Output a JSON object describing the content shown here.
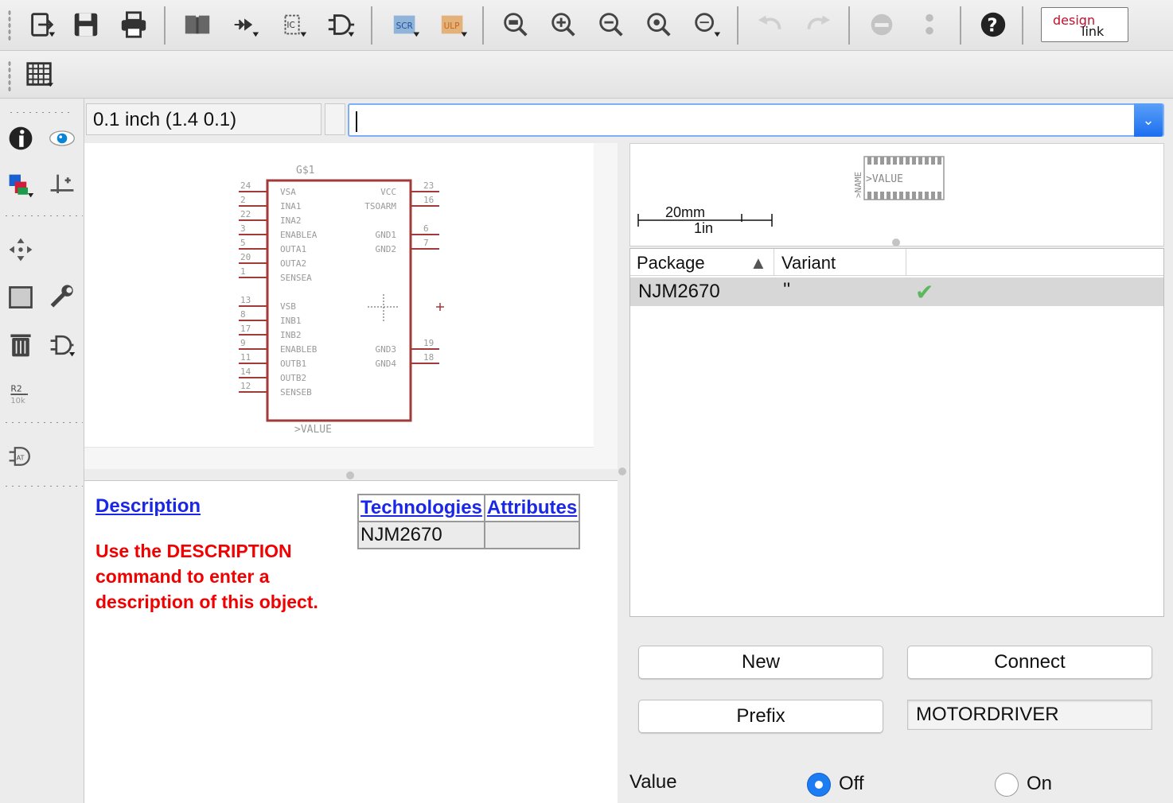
{
  "toolbar": {
    "buttons": [
      {
        "name": "export-icon"
      },
      {
        "name": "save-icon"
      },
      {
        "name": "print-icon"
      },
      {
        "name": "library-icon"
      },
      {
        "name": "pin-direction-icon"
      },
      {
        "name": "device-ic-icon"
      },
      {
        "name": "symbol-gate-icon"
      },
      {
        "name": "script-icon",
        "label": "SCR"
      },
      {
        "name": "ulp-icon",
        "label": "ULP"
      },
      {
        "name": "zoom-fit-icon"
      },
      {
        "name": "zoom-in-icon"
      },
      {
        "name": "zoom-out-icon"
      },
      {
        "name": "zoom-select-icon"
      },
      {
        "name": "zoom-last-icon"
      },
      {
        "name": "undo-icon"
      },
      {
        "name": "redo-icon"
      },
      {
        "name": "stop-icon"
      },
      {
        "name": "go-icon"
      },
      {
        "name": "help-icon"
      }
    ],
    "designlink_label_top": "design",
    "designlink_label_bottom": "link"
  },
  "grid_field": "0.1 inch (1.4 0.1)",
  "command": {
    "value": "",
    "placeholder": ""
  },
  "schematic": {
    "gate_name": "G$1",
    "value_label": ">VALUE",
    "left_pins": [
      {
        "num": "24",
        "name": "VSA"
      },
      {
        "num": "2",
        "name": "INA1"
      },
      {
        "num": "22",
        "name": "INA2"
      },
      {
        "num": "3",
        "name": "ENABLEA"
      },
      {
        "num": "5",
        "name": "OUTA1"
      },
      {
        "num": "20",
        "name": "OUTA2"
      },
      {
        "num": "1",
        "name": "SENSEA"
      },
      {
        "num": "13",
        "name": "VSB"
      },
      {
        "num": "8",
        "name": "INB1"
      },
      {
        "num": "17",
        "name": "INB2"
      },
      {
        "num": "9",
        "name": "ENABLEB"
      },
      {
        "num": "11",
        "name": "OUTB1"
      },
      {
        "num": "14",
        "name": "OUTB2"
      },
      {
        "num": "12",
        "name": "SENSEB"
      }
    ],
    "right_pins": [
      {
        "num": "23",
        "name": "VCC"
      },
      {
        "num": "16",
        "name": "TSOARM"
      },
      {
        "num": "6",
        "name": "GND1"
      },
      {
        "num": "7",
        "name": "GND2"
      },
      {
        "num": "19",
        "name": "GND3"
      },
      {
        "num": "18",
        "name": "GND4"
      }
    ]
  },
  "description": {
    "title": "Description",
    "text": "Use the DESCRIPTION command to enter a description of this object."
  },
  "tech_table": {
    "headers": [
      "Technologies",
      "Attributes"
    ],
    "rows": [
      [
        "NJM2670",
        ""
      ]
    ]
  },
  "package_preview": {
    "name_label": ">NAME",
    "value_label": ">VALUE",
    "scale_top": "20mm",
    "scale_bottom": "1in"
  },
  "package_table": {
    "headers": [
      "Package",
      "Variant",
      ""
    ],
    "sort_indicator": "▲",
    "rows": [
      {
        "package": "NJM2670",
        "variant": "''",
        "connected": "✔"
      }
    ]
  },
  "buttons": {
    "new": "New",
    "connect": "Connect",
    "prefix": "Prefix"
  },
  "prefix_value": "MOTORDRIVER",
  "value_setting": {
    "label": "Value",
    "off": "Off",
    "on": "On",
    "selected": "off"
  },
  "colors": {
    "accent": "#1c7cf2",
    "symbol": "#a33a3a",
    "link": "#1b27e6",
    "desc_text": "#f20000",
    "check": "#5cb85c"
  }
}
